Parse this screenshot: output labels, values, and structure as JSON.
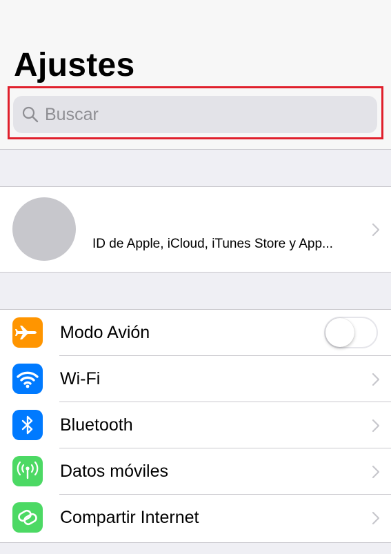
{
  "header": {
    "title": "Ajustes"
  },
  "search": {
    "placeholder": "Buscar",
    "value": "",
    "icon": "search-icon"
  },
  "profile": {
    "subtitle": "ID de Apple, iCloud, iTunes Store y App..."
  },
  "settings": {
    "items": [
      {
        "label": "Modo Avión",
        "icon": "airplane-icon",
        "color": "#ff9500",
        "control": "toggle",
        "toggle_on": false
      },
      {
        "label": "Wi-Fi",
        "icon": "wifi-icon",
        "color": "#007aff",
        "control": "chevron"
      },
      {
        "label": "Bluetooth",
        "icon": "bluetooth-icon",
        "color": "#007aff",
        "control": "chevron"
      },
      {
        "label": "Datos móviles",
        "icon": "antenna-icon",
        "color": "#4cd964",
        "control": "chevron"
      },
      {
        "label": "Compartir Internet",
        "icon": "hotspot-link-icon",
        "color": "#4cd964",
        "control": "chevron"
      }
    ]
  },
  "colors": {
    "highlight_border": "#e0202c",
    "background": "#efeff4",
    "separator": "#c8c7cc",
    "chevron": "#c7c7cc"
  }
}
